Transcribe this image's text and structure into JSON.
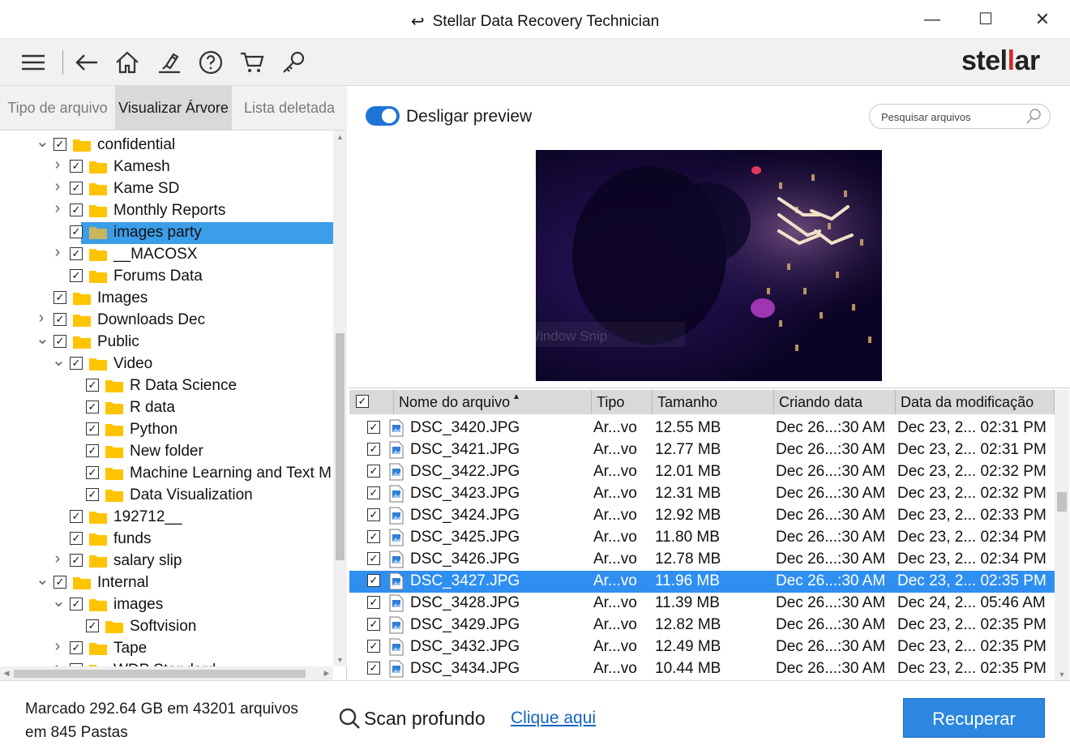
{
  "window": {
    "title": "Stellar Data Recovery Technician",
    "minimize": "—",
    "maximize": "☐",
    "close": "✕"
  },
  "toolbar": {
    "buttons": [
      "menu-icon",
      "back-icon",
      "home-icon",
      "scan-icon",
      "help-icon",
      "cart-icon",
      "key-icon"
    ],
    "brand_left": "stel",
    "brand_bars": "l",
    "brand_right": "ar"
  },
  "left_tabs": [
    "Tipo de arquivo",
    "Visualizar Árvore",
    "Lista deletada"
  ],
  "tree": [
    {
      "label": "confidential",
      "level": 0,
      "expander": "down",
      "checked": true
    },
    {
      "label": "Kamesh",
      "level": 1,
      "expander": "right",
      "checked": true
    },
    {
      "label": "Kame SD",
      "level": 1,
      "expander": "right",
      "checked": true
    },
    {
      "label": "Monthly Reports",
      "level": 1,
      "expander": "right",
      "checked": true
    },
    {
      "label": "images party",
      "level": 1,
      "expander": "none",
      "checked": true,
      "selected": true
    },
    {
      "label": "__MACOSX",
      "level": 1,
      "expander": "right",
      "checked": true
    },
    {
      "label": "Forums Data",
      "level": 1,
      "expander": "none",
      "checked": true
    },
    {
      "label": "Images",
      "level": 0,
      "expander": "none",
      "checked": true
    },
    {
      "label": "Downloads Dec",
      "level": 0,
      "expander": "right",
      "checked": true
    },
    {
      "label": "Public",
      "level": 0,
      "expander": "down",
      "checked": true
    },
    {
      "label": "Video",
      "level": 1,
      "expander": "down",
      "checked": true
    },
    {
      "label": "R Data Science",
      "level": 2,
      "expander": "none",
      "checked": true
    },
    {
      "label": "R data",
      "level": 2,
      "expander": "none",
      "checked": true
    },
    {
      "label": "Python",
      "level": 2,
      "expander": "none",
      "checked": true
    },
    {
      "label": "New folder",
      "level": 2,
      "expander": "none",
      "checked": true
    },
    {
      "label": "Machine Learning and Text M",
      "level": 2,
      "expander": "none",
      "checked": true
    },
    {
      "label": "Data Visualization",
      "level": 2,
      "expander": "none",
      "checked": true
    },
    {
      "label": "192712__",
      "level": 1,
      "expander": "none",
      "checked": true
    },
    {
      "label": "funds",
      "level": 1,
      "expander": "none",
      "checked": true
    },
    {
      "label": "salary slip",
      "level": 1,
      "expander": "right",
      "checked": true
    },
    {
      "label": "Internal",
      "level": 0,
      "expander": "down",
      "checked": true
    },
    {
      "label": "images",
      "level": 1,
      "expander": "down",
      "checked": true
    },
    {
      "label": "Softvision",
      "level": 2,
      "expander": "none",
      "checked": true
    },
    {
      "label": "Tape",
      "level": 1,
      "expander": "right",
      "checked": true
    },
    {
      "label": "WDP Standard",
      "level": 1,
      "expander": "right",
      "checked": true
    }
  ],
  "preview": {
    "toggle_on": true,
    "toggle_label": "Desligar preview",
    "search_placeholder": "Pesquisar arquivos",
    "overlay_text": "Window Snip"
  },
  "table": {
    "columns": [
      "Nome do arquivo",
      "Tipo",
      "Tamanho",
      "Criando data",
      "Data da modificação"
    ],
    "rows": [
      {
        "name": "DSC_3420.JPG",
        "type": "Ar...vo",
        "size": "12.55 MB",
        "created": "Dec 26...:30 AM",
        "modified": "Dec 23, 2... 02:31 PM"
      },
      {
        "name": "DSC_3421.JPG",
        "type": "Ar...vo",
        "size": "12.77 MB",
        "created": "Dec 26...:30 AM",
        "modified": "Dec 23, 2... 02:31 PM"
      },
      {
        "name": "DSC_3422.JPG",
        "type": "Ar...vo",
        "size": "12.01 MB",
        "created": "Dec 26...:30 AM",
        "modified": "Dec 23, 2... 02:32 PM"
      },
      {
        "name": "DSC_3423.JPG",
        "type": "Ar...vo",
        "size": "12.31 MB",
        "created": "Dec 26...:30 AM",
        "modified": "Dec 23, 2... 02:32 PM"
      },
      {
        "name": "DSC_3424.JPG",
        "type": "Ar...vo",
        "size": "12.92 MB",
        "created": "Dec 26...:30 AM",
        "modified": "Dec 23, 2... 02:33 PM"
      },
      {
        "name": "DSC_3425.JPG",
        "type": "Ar...vo",
        "size": "11.80 MB",
        "created": "Dec 26...:30 AM",
        "modified": "Dec 23, 2... 02:34 PM"
      },
      {
        "name": "DSC_3426.JPG",
        "type": "Ar...vo",
        "size": "12.78 MB",
        "created": "Dec 26...:30 AM",
        "modified": "Dec 23, 2... 02:34 PM"
      },
      {
        "name": "DSC_3427.JPG",
        "type": "Ar...vo",
        "size": "11.96 MB",
        "created": "Dec 26...:30 AM",
        "modified": "Dec 23, 2... 02:35 PM",
        "selected": true
      },
      {
        "name": "DSC_3428.JPG",
        "type": "Ar...vo",
        "size": "11.39 MB",
        "created": "Dec 26...:30 AM",
        "modified": "Dec 24, 2... 05:46 AM"
      },
      {
        "name": "DSC_3429.JPG",
        "type": "Ar...vo",
        "size": "12.82 MB",
        "created": "Dec 26...:30 AM",
        "modified": "Dec 23, 2... 02:35 PM"
      },
      {
        "name": "DSC_3432.JPG",
        "type": "Ar...vo",
        "size": "12.49 MB",
        "created": "Dec 26...:30 AM",
        "modified": "Dec 23, 2... 02:35 PM"
      },
      {
        "name": "DSC_3434.JPG",
        "type": "Ar...vo",
        "size": "10.44 MB",
        "created": "Dec 26...:30 AM",
        "modified": "Dec 23, 2... 02:35 PM"
      }
    ]
  },
  "footer": {
    "status_line1": "Marcado 292.64 GB em 43201 arquivos",
    "status_line2": "em 845 Pastas",
    "deep_scan_label": "Scan profundo",
    "deep_scan_link": "Clique aqui",
    "recover_label": "Recuperar"
  },
  "colors": {
    "accent": "#2b87e0",
    "selection": "#3c9de8",
    "folder": "#ffc400",
    "brand_red": "#d32b2b",
    "link": "#1565c0"
  }
}
